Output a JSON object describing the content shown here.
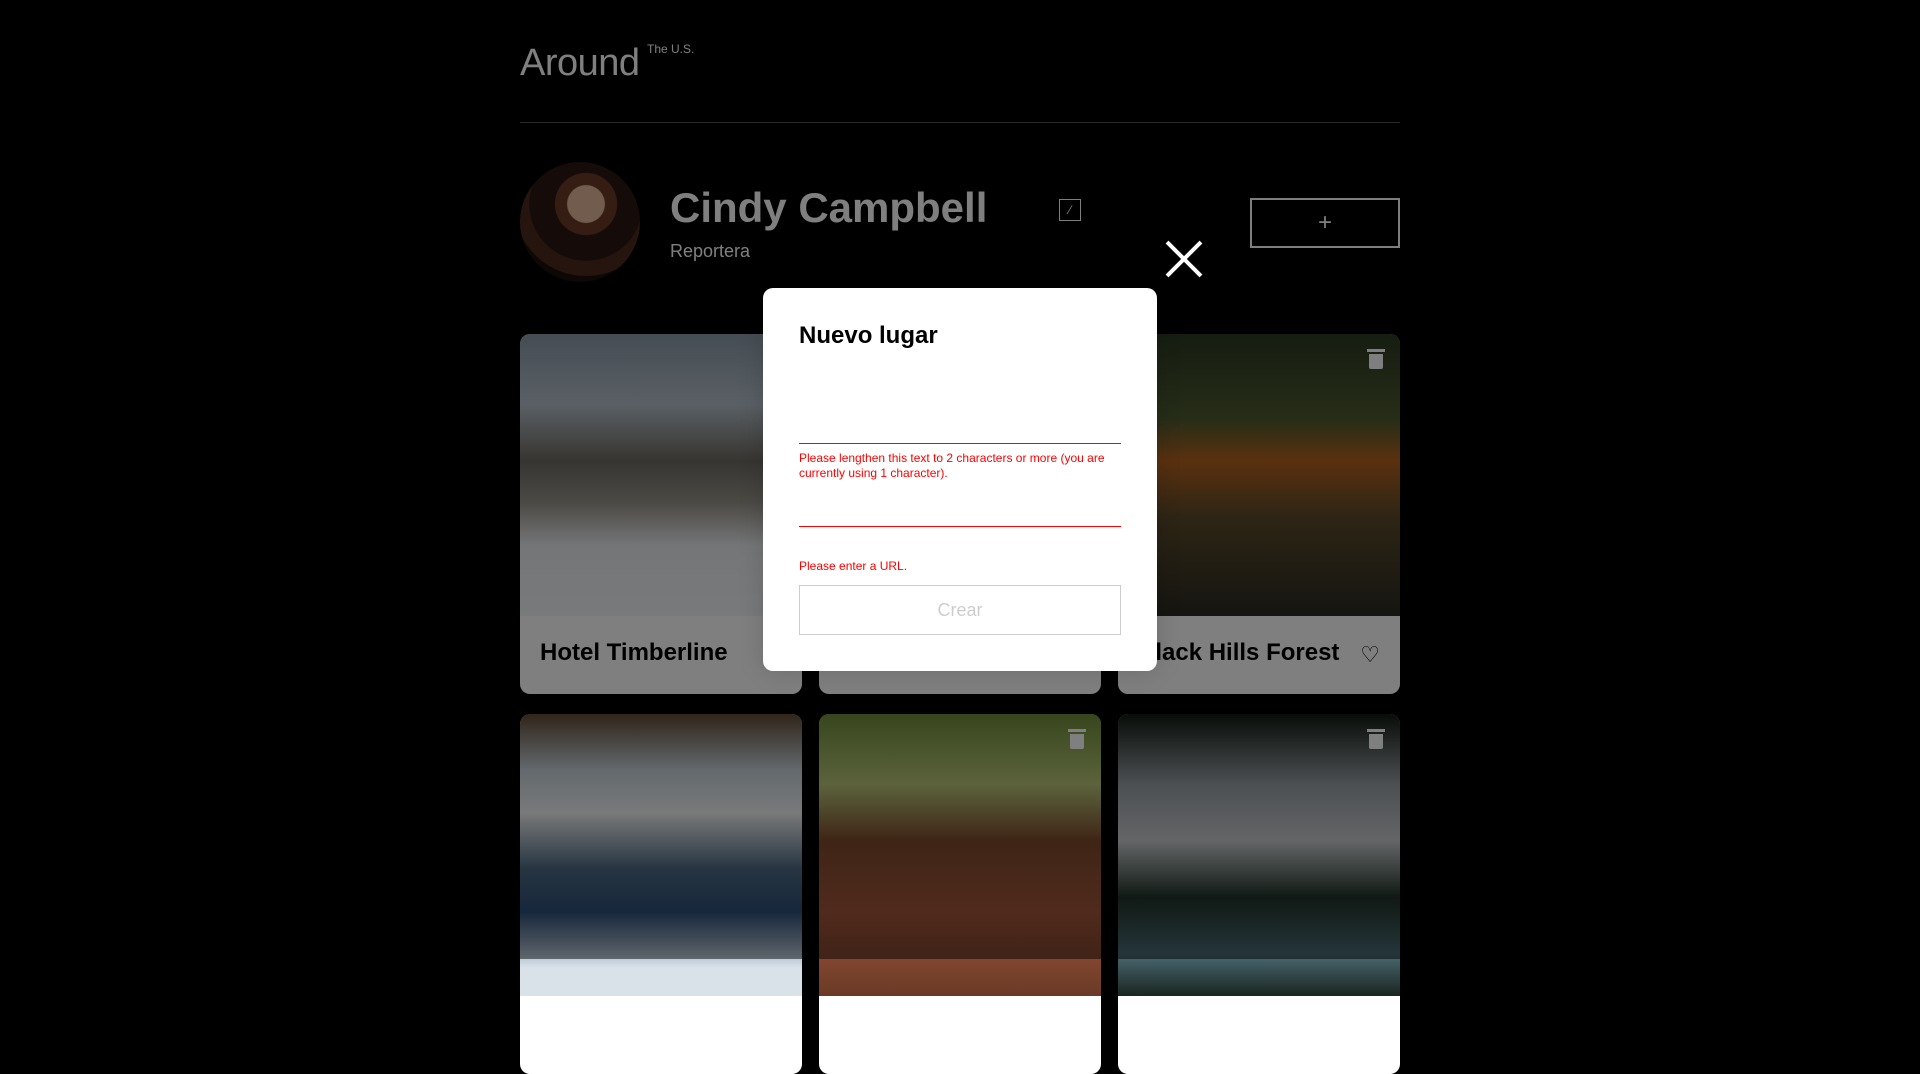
{
  "header": {
    "logo": "Around",
    "logo_sup": "The U.S."
  },
  "profile": {
    "name": "Cindy Campbell",
    "job": "Reportera",
    "add_label": "+"
  },
  "cards": [
    {
      "title": "Hotel Timberline"
    },
    {
      "title": ""
    },
    {
      "title": "Black Hills Forest"
    },
    {
      "title": ""
    },
    {
      "title": ""
    },
    {
      "title": ""
    }
  ],
  "modal": {
    "title": "Nuevo lugar",
    "title_field": {
      "value": "",
      "error": "Please lengthen this text to 2 characters or more (you are currently using 1 character)."
    },
    "link_field": {
      "value": "",
      "error": "Please enter a URL."
    },
    "submit_label": "Crear"
  },
  "icons": {
    "close": "close-icon",
    "edit": "pencil-icon",
    "like": "heart-icon",
    "trash": "trash-icon",
    "add": "plus-icon"
  }
}
